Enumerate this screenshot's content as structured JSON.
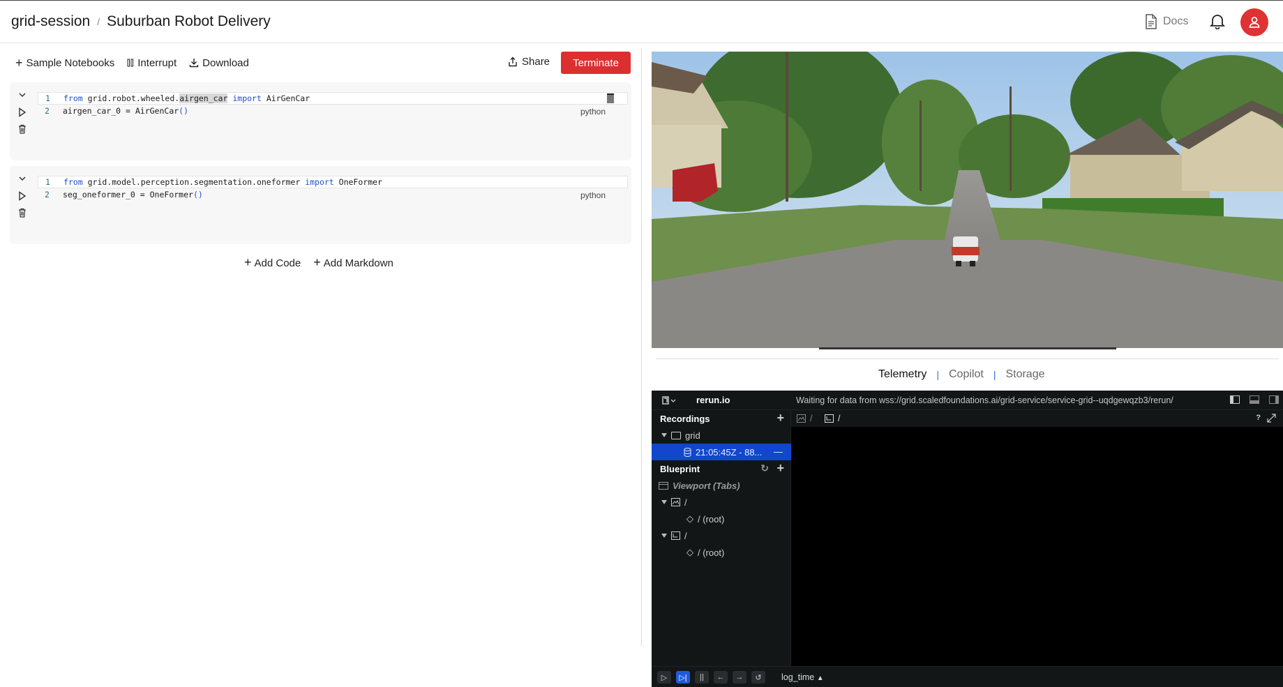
{
  "header": {
    "workspace": "grid-session",
    "separator": "/",
    "session_title": "Suburban Robot Delivery",
    "docs_label": "Docs"
  },
  "toolbar": {
    "sample_notebooks": "Sample Notebooks",
    "interrupt": "Interrupt",
    "download": "Download",
    "share": "Share",
    "terminate": "Terminate"
  },
  "cells": [
    {
      "language": "python",
      "lines": [
        {
          "num": "1",
          "kw1": "from",
          "module_pre": " grid.robot.wheeled.",
          "module_hl": "airgen_car",
          "kw2": " import",
          "name": " AirGenCar"
        },
        {
          "num": "2",
          "text": "airgen_car_0 = AirGenCar",
          "paren": "()"
        }
      ]
    },
    {
      "language": "python",
      "lines": [
        {
          "num": "1",
          "kw1": "from",
          "module": " grid.model.perception.segmentation.oneformer",
          "kw2": " import",
          "name": " OneFormer"
        },
        {
          "num": "2",
          "text": "seg_oneformer_0 = OneFormer",
          "paren": "()"
        }
      ]
    }
  ],
  "add_buttons": {
    "code": "Add Code",
    "markdown": "Add Markdown"
  },
  "right_tabs": [
    "Telemetry",
    "Copilot",
    "Storage"
  ],
  "tab_separator": "|",
  "rerun": {
    "app_name": "rerun.io",
    "status": "Waiting for data from wss://grid.scaledfoundations.ai/grid-service/service-grid--uqdgewqzb3/rerun/",
    "recordings_label": "Recordings",
    "recording_app": "grid",
    "recording_item": "21:05:45Z - 88...",
    "blueprint_label": "Blueprint",
    "viewport_label": "Viewport (Tabs)",
    "tree": [
      {
        "label": "/"
      },
      {
        "label": "/ (root)"
      },
      {
        "label": "/"
      },
      {
        "label": "/ (root)"
      }
    ],
    "path_a": "/",
    "path_b": "/",
    "help": "?",
    "timeline": "log_time"
  },
  "colors": {
    "accent_red": "#dc2f2f",
    "rerun_select": "#1147cc",
    "keyword_blue": "#1f4fd1"
  }
}
